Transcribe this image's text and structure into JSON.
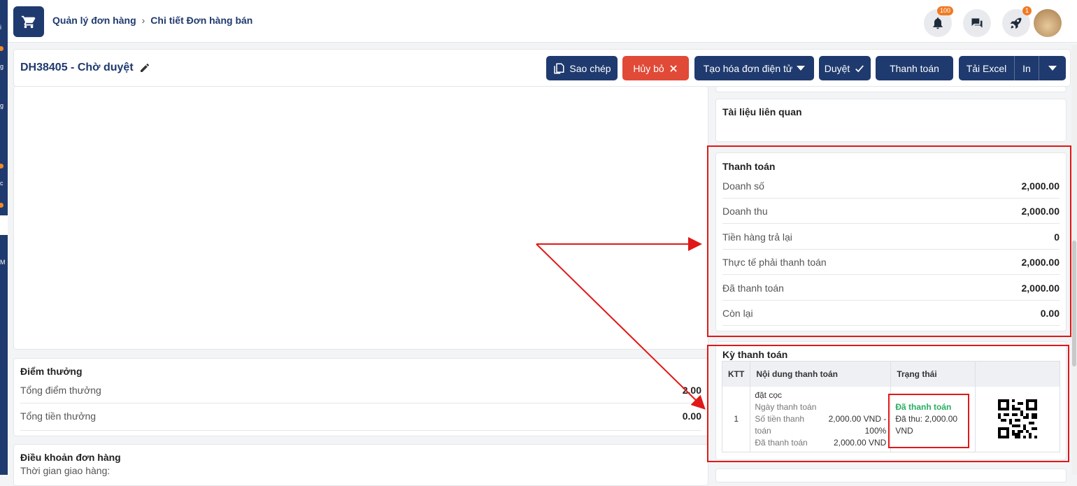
{
  "breadcrumb": {
    "parent": "Quản lý đơn hàng",
    "current": "Chi tiết Đơn hàng bán"
  },
  "notifications": {
    "bell_count": "100",
    "rocket_count": "1"
  },
  "sidenav_labels": [
    "i",
    "g",
    "g",
    "c",
    "M"
  ],
  "order": {
    "title": "DH38405 - Chờ duyệt"
  },
  "actions": {
    "copy": "Sao chép",
    "cancel": "Hủy bỏ",
    "einvoice": "Tạo hóa đơn điện tử",
    "approve": "Duyệt",
    "pay": "Thanh toán",
    "excel": "Tải Excel",
    "print": "In"
  },
  "related_docs": {
    "title": "Tài liệu liên quan"
  },
  "payment": {
    "title": "Thanh toán",
    "rows": [
      {
        "label": "Doanh số",
        "value": "2,000.00"
      },
      {
        "label": "Doanh thu",
        "value": "2,000.00"
      },
      {
        "label": "Tiền hàng trả lại",
        "value": "0"
      },
      {
        "label": "Thực tế phải thanh toán",
        "value": "2,000.00"
      },
      {
        "label": "Đã thanh toán",
        "value": "2,000.00"
      },
      {
        "label": "Còn lại",
        "value": "0.00"
      }
    ]
  },
  "installments": {
    "title": "Kỳ thanh toán",
    "headers": [
      "KTT",
      "Nội dung thanh toán",
      "Trạng thái",
      ""
    ],
    "row": {
      "ktt": "1",
      "content": "đặt cọc",
      "date_label": "Ngày thanh toán",
      "amount_label": "Số tiền thanh toán",
      "amount_value": "2,000.00 VND -",
      "percent": "100%",
      "paid_label": "Đã thanh toán",
      "paid_value": "2,000.00 VND",
      "status": "Đã thanh toán",
      "collected": "Đã thu: 2,000.00 VND"
    }
  },
  "reward": {
    "title": "Điểm thưởng",
    "rows": [
      {
        "label": "Tổng điểm thưởng",
        "value": "2.00"
      },
      {
        "label": "Tổng tiền thưởng",
        "value": "0.00"
      }
    ]
  },
  "terms": {
    "title": "Điều khoản đơn hàng",
    "delivery_label": "Thời gian giao hàng:"
  },
  "colors": {
    "primary": "#1f3a6e",
    "danger": "#e04a37",
    "success": "#27ae60",
    "highlight": "#e01818"
  }
}
